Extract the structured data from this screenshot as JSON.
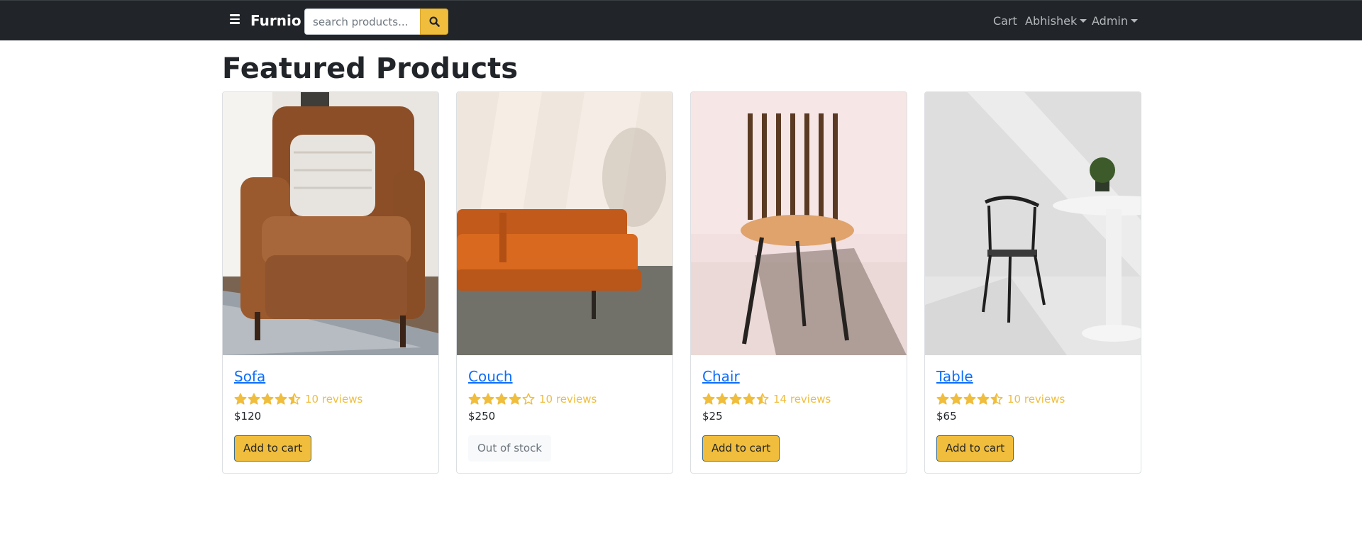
{
  "navbar": {
    "brand": "Furnio",
    "search": {
      "placeholder": "search products...",
      "value": ""
    },
    "links": {
      "cart": "Cart",
      "user": "Abhishek",
      "admin": "Admin"
    }
  },
  "page": {
    "title": "Featured Products"
  },
  "products": [
    {
      "name": "Sofa",
      "rating": 4.5,
      "reviews": "10 reviews",
      "price": "$120",
      "action": "Add to cart",
      "in_stock": true,
      "image": "leather-armchair-photo"
    },
    {
      "name": "Couch",
      "rating": 4,
      "reviews": "10 reviews",
      "price": "$250",
      "action": "Out of stock",
      "in_stock": false,
      "image": "orange-leather-couch-photo"
    },
    {
      "name": "Chair",
      "rating": 4.5,
      "reviews": "14 reviews",
      "price": "$25",
      "action": "Add to cart",
      "in_stock": true,
      "image": "wooden-slat-chair-photo"
    },
    {
      "name": "Table",
      "rating": 4.5,
      "reviews": "10 reviews",
      "price": "$65",
      "action": "Add to cart",
      "in_stock": true,
      "image": "white-table-black-chair-photo"
    }
  ],
  "colors": {
    "navbar": "#212529",
    "accent": "#f0bd3c",
    "link": "#0d6efd"
  }
}
